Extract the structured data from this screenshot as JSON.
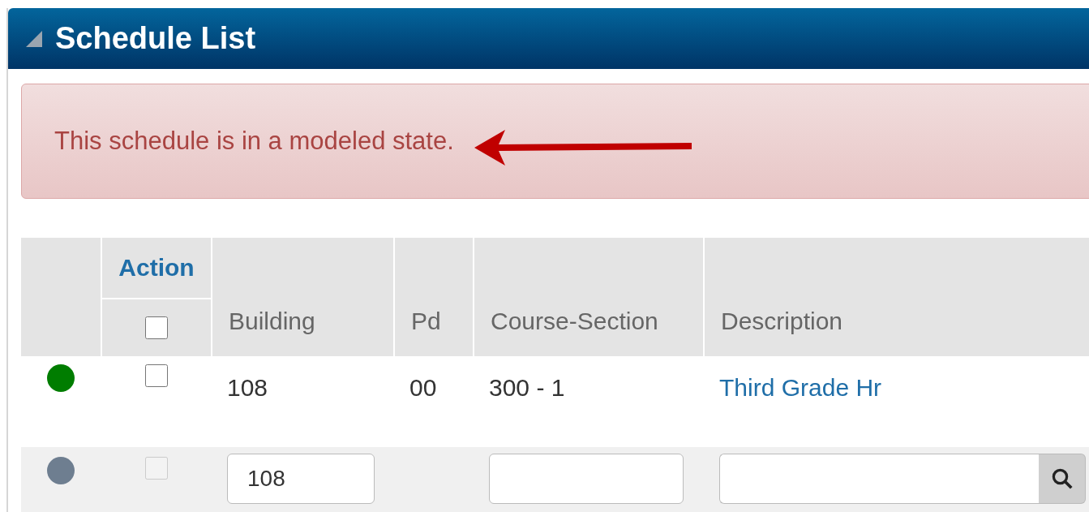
{
  "panel": {
    "title": "Schedule List",
    "expanded": true
  },
  "alert": {
    "message": "This schedule is in a modeled state."
  },
  "table": {
    "group_heading": "Action",
    "select_all": {
      "checked": false
    },
    "columns": [
      "Building",
      "Pd",
      "Course-Section",
      "Description"
    ],
    "rows": [
      {
        "color": "#007d00",
        "checked": false,
        "building": "108",
        "pd": "00",
        "course_section": "300 - 1",
        "description": "Third Grade Hr"
      }
    ],
    "new_row": {
      "color": "#6e7e90",
      "checkbox_disabled": true,
      "building": "108"
    }
  }
}
